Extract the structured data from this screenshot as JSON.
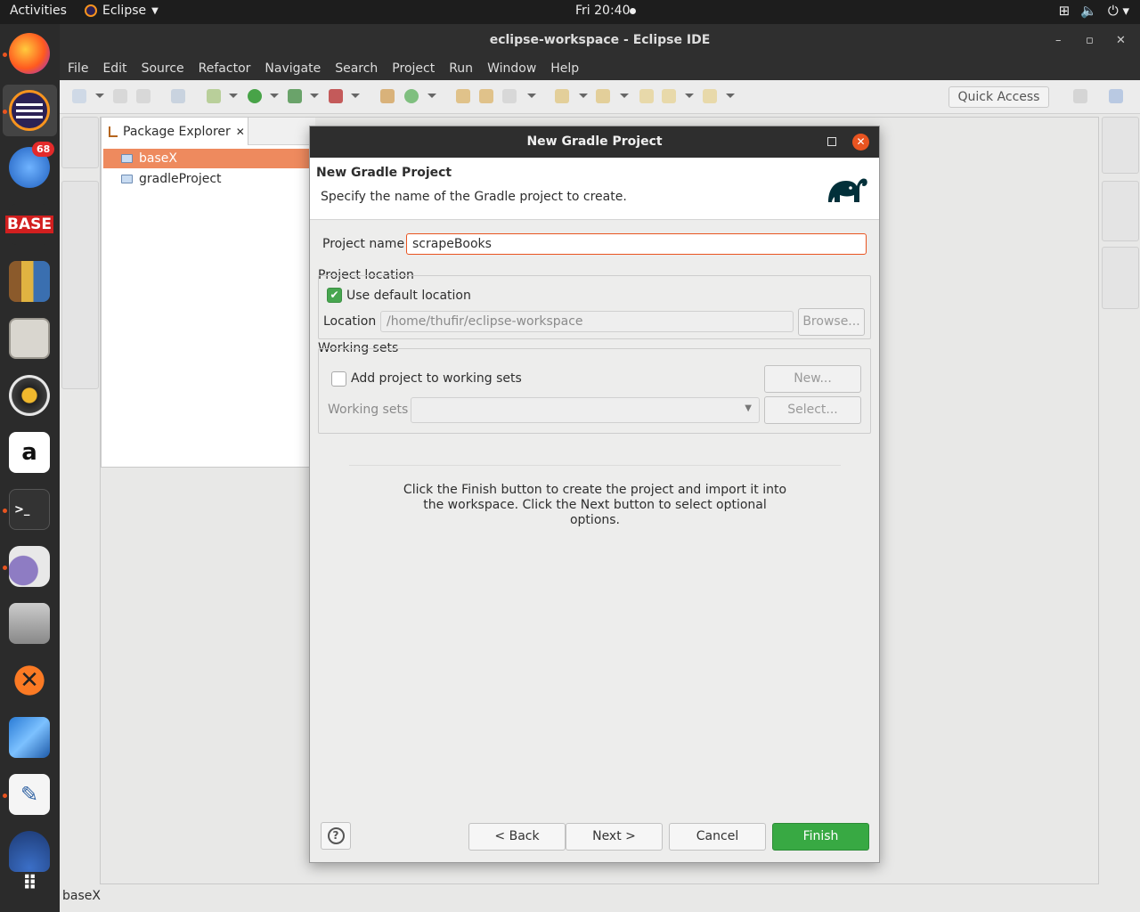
{
  "topbar": {
    "activities": "Activities",
    "app_name": "Eclipse",
    "clock": "Fri 20:40"
  },
  "dock": {
    "badge_count": "68",
    "items": [
      "firefox-icon",
      "eclipse-icon",
      "thunderbird-icon",
      "basex-icon",
      "calibre-icon",
      "files-icon",
      "rhythmbox-icon",
      "amazon-icon",
      "terminal-icon",
      "pidgin-icon",
      "installer-icon",
      "xampp-icon",
      "virtualbox-icon",
      "text-editor-icon",
      "updates-icon",
      "show-apps-icon"
    ],
    "basex_label": "BASE"
  },
  "window": {
    "title": "eclipse-workspace - Eclipse IDE",
    "menu": [
      "File",
      "Edit",
      "Source",
      "Refactor",
      "Navigate",
      "Search",
      "Project",
      "Run",
      "Window",
      "Help"
    ],
    "quick_access": "Quick Access"
  },
  "package_explorer": {
    "tab_label": "Package Explorer",
    "items": [
      {
        "label": "baseX",
        "selected": true
      },
      {
        "label": "gradleProject",
        "selected": false
      }
    ]
  },
  "status_bar": {
    "text": "baseX"
  },
  "dialog": {
    "title": "New Gradle Project",
    "header_title": "New Gradle Project",
    "header_desc": "Specify the name of the Gradle project to create.",
    "project_name_label": "Project name",
    "project_name_value": "scrapeBooks",
    "project_location_group": "Project location",
    "use_default_location": "Use default location",
    "location_label": "Location",
    "location_value": "/home/thufir/eclipse-workspace",
    "browse_button": "Browse...",
    "working_sets_group": "Working sets",
    "add_to_working_sets": "Add project to working sets",
    "new_button": "New...",
    "working_sets_label": "Working sets",
    "select_button": "Select...",
    "info_text": "Click the Finish button to create the project and import it into the workspace. Click the Next button to select optional options.",
    "back_button": "< Back",
    "next_button": "Next >",
    "cancel_button": "Cancel",
    "finish_button": "Finish",
    "use_default_checked": true,
    "add_to_working_sets_checked": false
  },
  "colors": {
    "accent": "#e95420",
    "finish": "#38a943",
    "selection": "#ee8a5e"
  }
}
